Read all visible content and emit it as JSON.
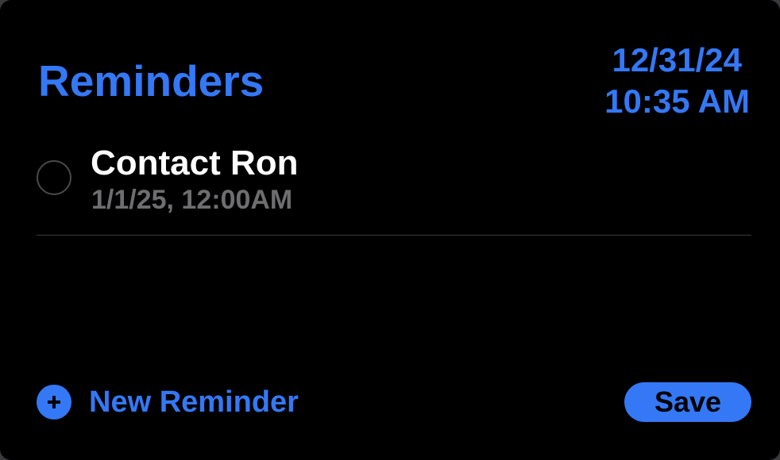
{
  "widget": {
    "title": "Reminders",
    "date": "12/31/24",
    "time": "10:35 AM"
  },
  "reminders": [
    {
      "title": "Contact Ron",
      "due": "1/1/25, 12:00AM",
      "completed": false
    }
  ],
  "footer": {
    "new_reminder_label": "New Reminder",
    "new_reminder_icon": "plus-circle-icon",
    "save_label": "Save"
  },
  "colors": {
    "accent": "#3478f6",
    "background": "#000000",
    "primary_text": "#ffffff",
    "secondary_text": "#6e6e70",
    "separator": "#3a3a3c"
  }
}
